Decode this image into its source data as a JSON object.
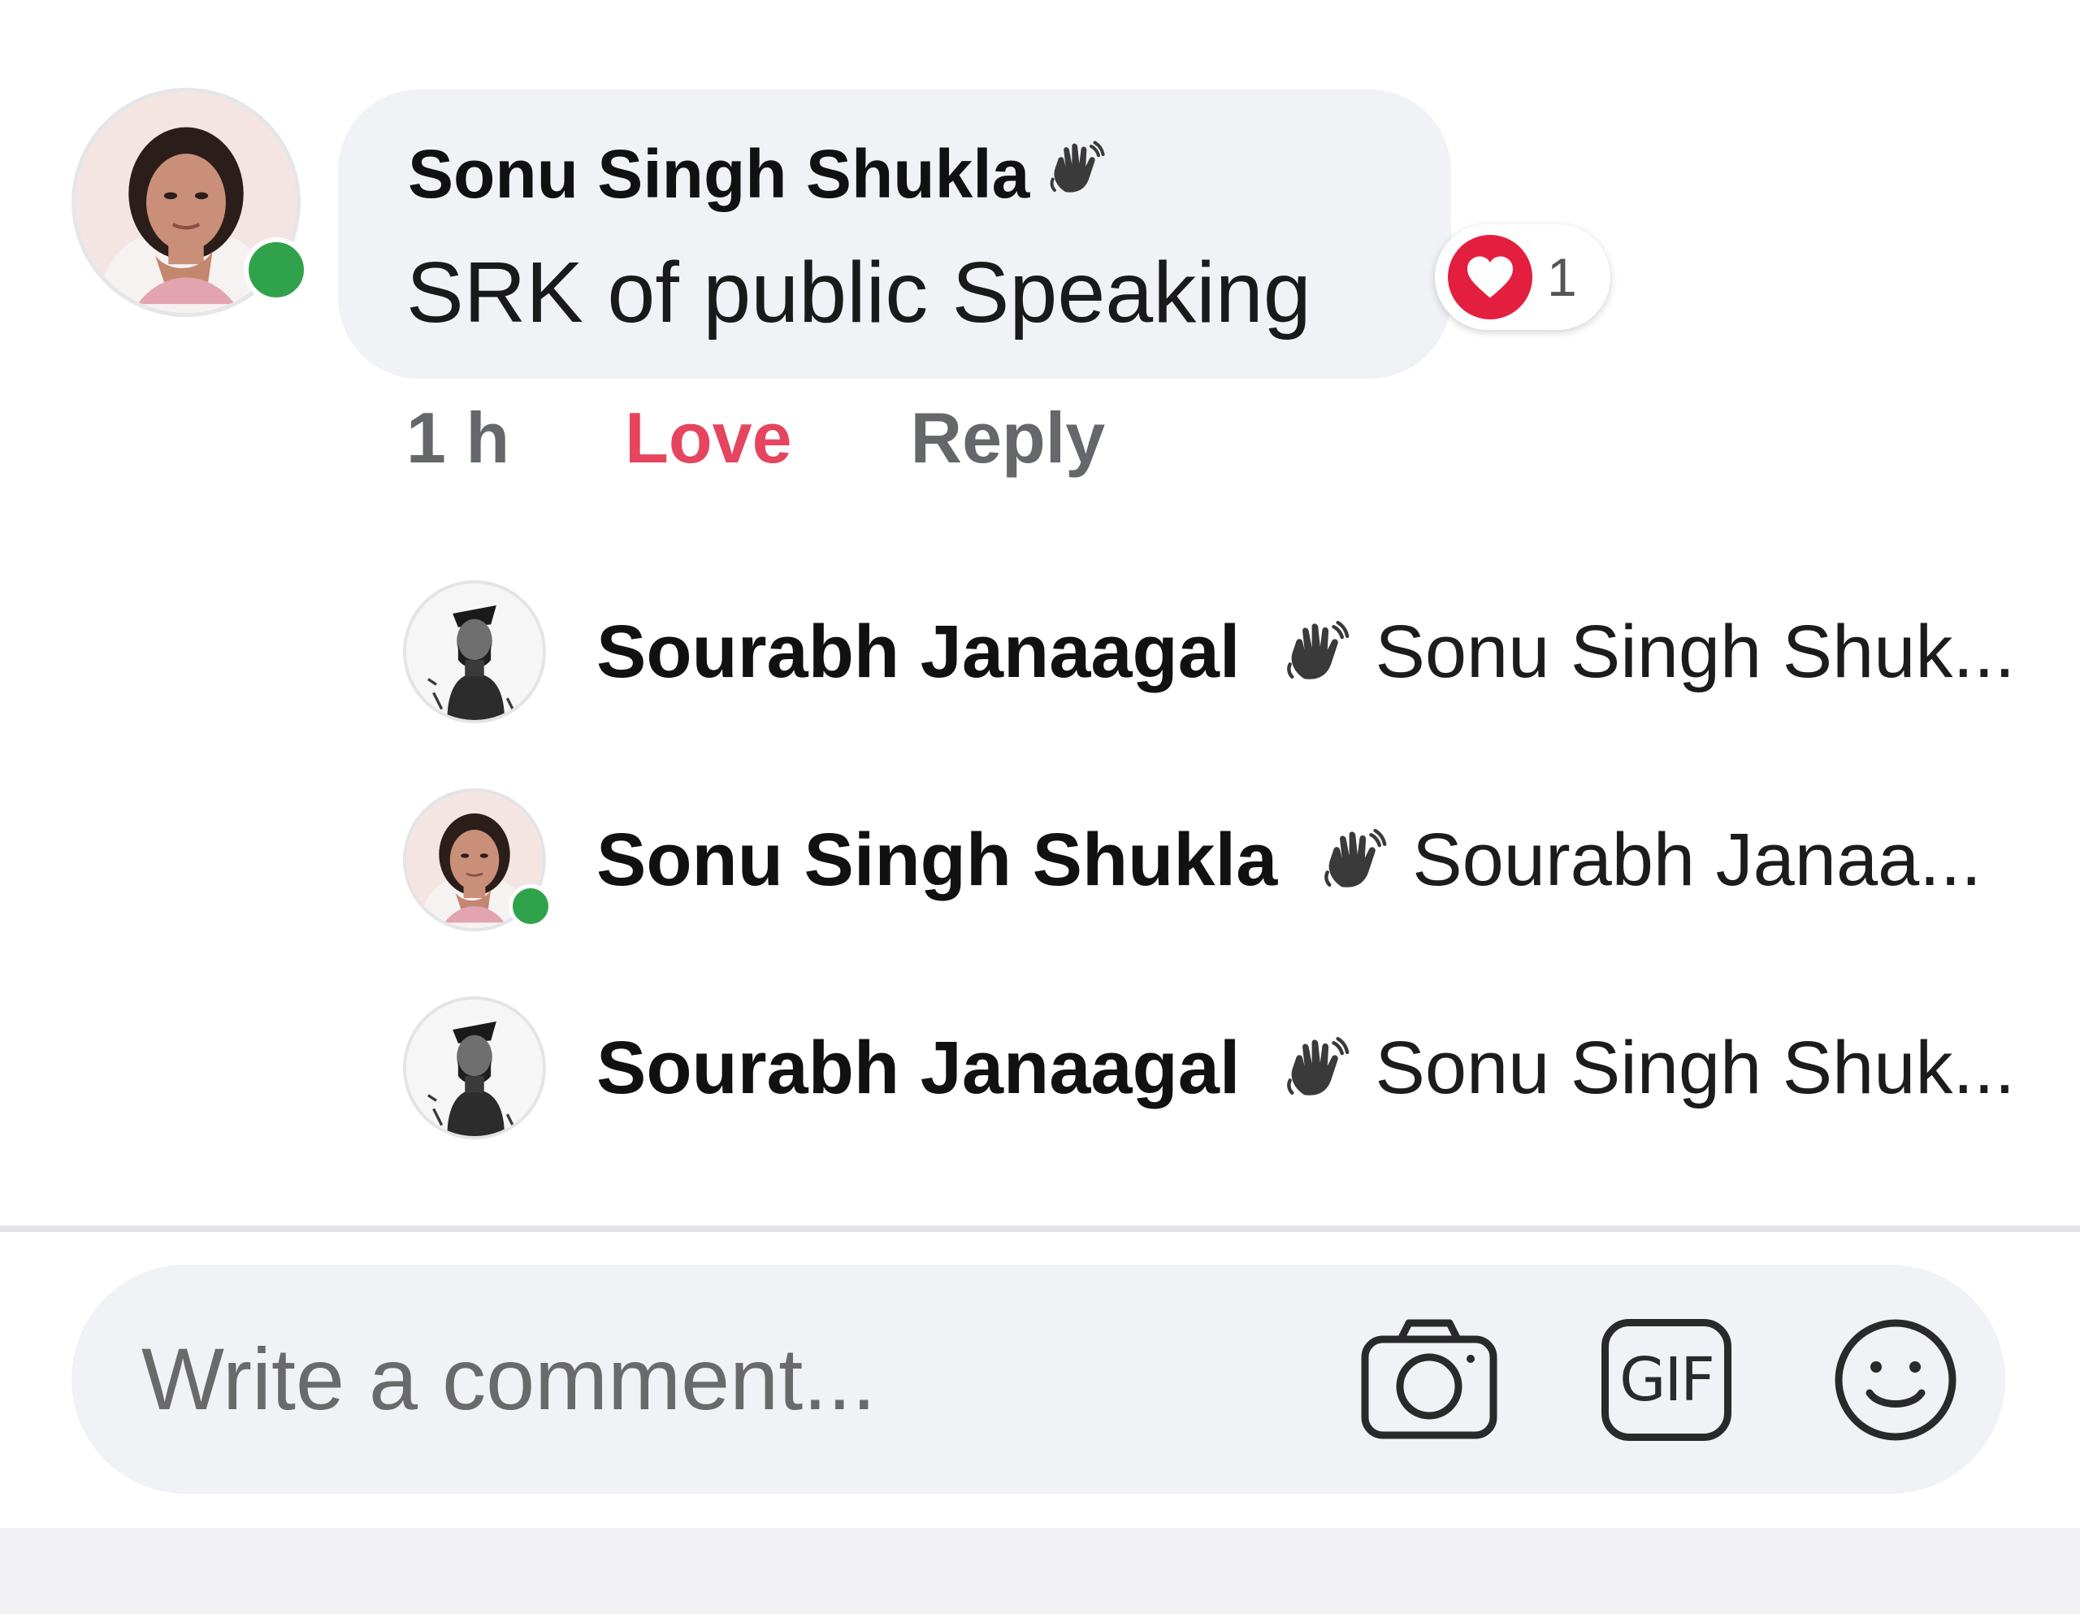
{
  "comment": {
    "author": "Sonu Singh Shukla",
    "text": "SRK of public Speaking",
    "reaction_count": "1",
    "time": "1 h",
    "love_label": "Love",
    "reply_label": "Reply",
    "badge_icon": "wave-hand-icon"
  },
  "replies": [
    {
      "author": "Sourabh Janaagal",
      "preview": "Sonu Singh Shuk..."
    },
    {
      "author": "Sonu Singh Shukla",
      "preview": "Sourabh Janaa..."
    },
    {
      "author": "Sourabh Janaagal",
      "preview": "Sonu Singh Shuk..."
    }
  ],
  "composer": {
    "placeholder": "Write a comment...",
    "gif_label": "GIF",
    "icons": [
      "camera-icon",
      "gif-icon",
      "smiley-icon"
    ]
  },
  "colors": {
    "love": "#e5455f",
    "reaction_heart": "#e41e3f",
    "online": "#31a24c",
    "bubble": "#f0f2f5",
    "meta_gray": "#65676b"
  }
}
